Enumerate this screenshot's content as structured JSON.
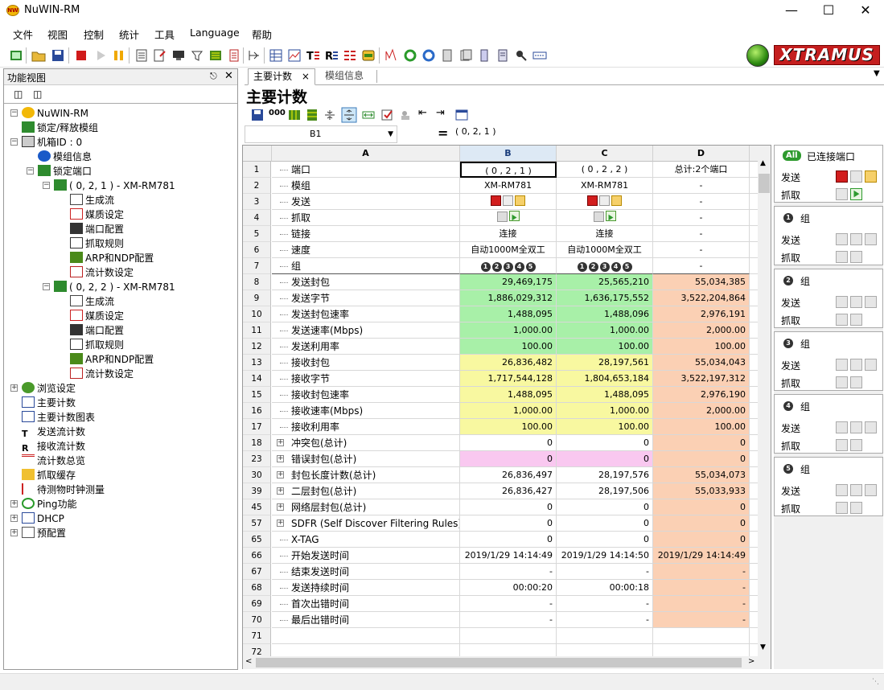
{
  "window": {
    "title": "NuWIN-RM",
    "logo_text": "NW"
  },
  "menu": [
    "文件",
    "视图",
    "控制",
    "统计",
    "工具",
    "Language",
    "帮助"
  ],
  "brand": {
    "text": "XTRAMUS"
  },
  "left_panel": {
    "title": "功能视图"
  },
  "tree": [
    {
      "label": "NuWIN-RM",
      "icon": "app-icon"
    },
    {
      "label": "锁定/释放模组",
      "icon": "lock-icon"
    },
    {
      "label": "机箱ID : 0",
      "icon": "chassis-icon"
    },
    {
      "label": "模组信息",
      "icon": "info-icon"
    },
    {
      "label": "锁定端口",
      "icon": "port-icon"
    },
    {
      "label": "( 0, 2, 1 ) - XM-RM781",
      "icon": "port-icon"
    },
    {
      "label": "生成流",
      "icon": "stream-icon"
    },
    {
      "label": "媒质设定",
      "icon": "media-icon"
    },
    {
      "label": "端口配置",
      "icon": "config-icon"
    },
    {
      "label": "抓取规则",
      "icon": "capture-icon"
    },
    {
      "label": "ARP和NDP配置",
      "icon": "arp-icon"
    },
    {
      "label": "流计数设定",
      "icon": "counter-icon"
    },
    {
      "label": "( 0, 2, 2 ) - XM-RM781",
      "icon": "port-icon"
    },
    {
      "label": "生成流",
      "icon": "stream-icon"
    },
    {
      "label": "媒质设定",
      "icon": "media-icon"
    },
    {
      "label": "端口配置",
      "icon": "config-icon"
    },
    {
      "label": "抓取规则",
      "icon": "capture-icon"
    },
    {
      "label": "ARP和NDP配置",
      "icon": "arp-icon"
    },
    {
      "label": "流计数设定",
      "icon": "counter-icon"
    },
    {
      "label": "浏览设定",
      "icon": "globe-icon"
    },
    {
      "label": "主要计数",
      "icon": "grid-icon"
    },
    {
      "label": "主要计数图表",
      "icon": "chart-icon"
    },
    {
      "label": "发送流计数",
      "icon": "tx-icon"
    },
    {
      "label": "接收流计数",
      "icon": "rx-icon"
    },
    {
      "label": "流计数总览",
      "icon": "overview-icon"
    },
    {
      "label": "抓取缓存",
      "icon": "buffer-icon"
    },
    {
      "label": "待测物时钟测量",
      "icon": "clock-icon"
    },
    {
      "label": "Ping功能",
      "icon": "ping-icon"
    },
    {
      "label": "DHCP",
      "icon": "dhcp-icon"
    },
    {
      "label": "预配置",
      "icon": "preset-icon"
    }
  ],
  "tabs": [
    {
      "label": "主要计数",
      "close": "×"
    },
    {
      "label": "模组信息"
    }
  ],
  "page_title": "主要计数",
  "formula": {
    "cell": "B1",
    "fx": "=",
    "value": "( 0, 2, 1 )"
  },
  "columns": [
    "A",
    "B",
    "C",
    "D"
  ],
  "rows": [
    {
      "n": "1",
      "a": "端口",
      "b": "( 0 , 2 , 1 )",
      "c": "( 0 , 2 , 2 )",
      "d": "总计:2个端口"
    },
    {
      "n": "2",
      "a": "模组",
      "b": "XM-RM781",
      "c": "XM-RM781",
      "d": "-"
    },
    {
      "n": "3",
      "a": "发送",
      "b": "",
      "c": "",
      "d": "-"
    },
    {
      "n": "4",
      "a": "抓取",
      "b": "",
      "c": "",
      "d": "-"
    },
    {
      "n": "5",
      "a": "链接",
      "b": "连接",
      "c": "连接",
      "d": "-"
    },
    {
      "n": "6",
      "a": "速度",
      "b": "自动1000M全双工",
      "c": "自动1000M全双工",
      "d": "-"
    },
    {
      "n": "7",
      "a": "组",
      "b": "",
      "c": "",
      "d": "-"
    },
    {
      "n": "8",
      "a": "发送封包",
      "b": "29,469,175",
      "c": "25,565,210",
      "d": "55,034,385"
    },
    {
      "n": "9",
      "a": "发送字节",
      "b": "1,886,029,312",
      "c": "1,636,175,552",
      "d": "3,522,204,864"
    },
    {
      "n": "10",
      "a": "发送封包速率",
      "b": "1,488,095",
      "c": "1,488,096",
      "d": "2,976,191"
    },
    {
      "n": "11",
      "a": "发送速率(Mbps)",
      "b": "1,000.00",
      "c": "1,000.00",
      "d": "2,000.00"
    },
    {
      "n": "12",
      "a": "发送利用率",
      "b": "100.00",
      "c": "100.00",
      "d": "100.00"
    },
    {
      "n": "13",
      "a": "接收封包",
      "b": "26,836,482",
      "c": "28,197,561",
      "d": "55,034,043"
    },
    {
      "n": "14",
      "a": "接收字节",
      "b": "1,717,544,128",
      "c": "1,804,653,184",
      "d": "3,522,197,312"
    },
    {
      "n": "15",
      "a": "接收封包速率",
      "b": "1,488,095",
      "c": "1,488,095",
      "d": "2,976,190"
    },
    {
      "n": "16",
      "a": "接收速率(Mbps)",
      "b": "1,000.00",
      "c": "1,000.00",
      "d": "2,000.00"
    },
    {
      "n": "17",
      "a": "接收利用率",
      "b": "100.00",
      "c": "100.00",
      "d": "100.00"
    },
    {
      "n": "18",
      "a": "冲突包(总计)",
      "b": "0",
      "c": "0",
      "d": "0"
    },
    {
      "n": "23",
      "a": "错误封包(总计)",
      "b": "0",
      "c": "0",
      "d": "0"
    },
    {
      "n": "30",
      "a": "封包长度计数(总计)",
      "b": "26,836,497",
      "c": "28,197,576",
      "d": "55,034,073"
    },
    {
      "n": "39",
      "a": "二层封包(总计)",
      "b": "26,836,427",
      "c": "28,197,506",
      "d": "55,033,933"
    },
    {
      "n": "45",
      "a": "网络层封包(总计)",
      "b": "0",
      "c": "0",
      "d": "0"
    },
    {
      "n": "57",
      "a": "SDFR (Self Discover Filtering Rules)(总计)",
      "b": "0",
      "c": "0",
      "d": "0"
    },
    {
      "n": "65",
      "a": "X-TAG",
      "b": "0",
      "c": "0",
      "d": "0"
    },
    {
      "n": "66",
      "a": "开始发送时间",
      "b": "2019/1/29 14:14:49",
      "c": "2019/1/29 14:14:50",
      "d": "2019/1/29 14:14:49"
    },
    {
      "n": "67",
      "a": "结束发送时间",
      "b": "-",
      "c": "-",
      "d": "-"
    },
    {
      "n": "68",
      "a": "发送持续时间",
      "b": "00:00:20",
      "c": "00:00:18",
      "d": "-"
    },
    {
      "n": "69",
      "a": "首次出错时间",
      "b": "-",
      "c": "-",
      "d": "-"
    },
    {
      "n": "70",
      "a": "最后出错时间",
      "b": "-",
      "c": "-",
      "d": "-"
    },
    {
      "n": "71",
      "a": "",
      "b": "",
      "c": "",
      "d": ""
    },
    {
      "n": "72",
      "a": "",
      "b": "",
      "c": "",
      "d": ""
    }
  ],
  "group_numbers": [
    "1",
    "2",
    "3",
    "4",
    "5"
  ],
  "right_panel": {
    "all": {
      "badge": "All",
      "title": "已连接端口"
    },
    "send": "发送",
    "capture": "抓取",
    "group_suffix": "组",
    "groups": [
      "1",
      "2",
      "3",
      "4",
      "5"
    ]
  },
  "colors": {
    "green": "#a8f0a8",
    "yellow": "#f8f8a0",
    "pink": "#f9c8f0",
    "salmon": "#fbd0b4",
    "brand": "#c41e1e"
  }
}
